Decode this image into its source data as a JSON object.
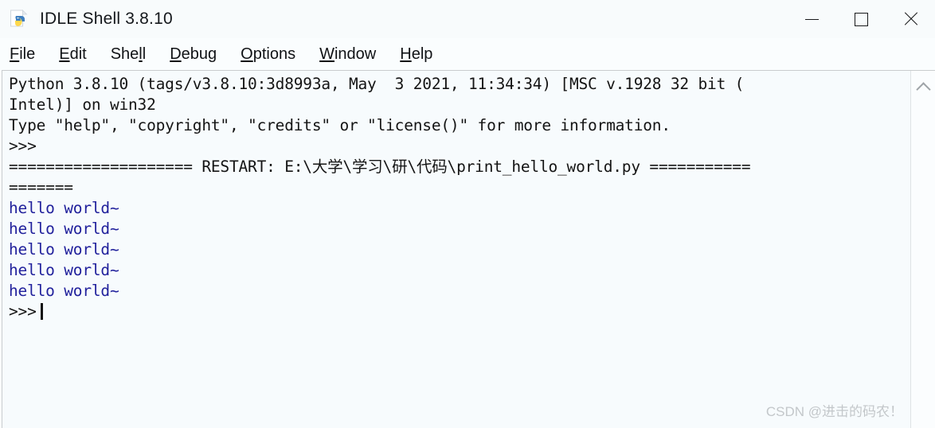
{
  "window": {
    "title": "IDLE Shell 3.8.10",
    "icon": "idle-python-icon",
    "controls": {
      "minimize": "—",
      "maximize": "☐",
      "close": "×"
    }
  },
  "menubar": {
    "items": [
      {
        "label": "File",
        "before": "",
        "mnemonic": "F",
        "after": "ile"
      },
      {
        "label": "Edit",
        "before": "",
        "mnemonic": "E",
        "after": "dit"
      },
      {
        "label": "Shell",
        "before": "She",
        "mnemonic": "l",
        "after": "l"
      },
      {
        "label": "Debug",
        "before": "",
        "mnemonic": "D",
        "after": "ebug"
      },
      {
        "label": "Options",
        "before": "",
        "mnemonic": "O",
        "after": "ptions"
      },
      {
        "label": "Window",
        "before": "",
        "mnemonic": "W",
        "after": "indow"
      },
      {
        "label": "Help",
        "before": "",
        "mnemonic": "H",
        "after": "elp"
      }
    ]
  },
  "shell": {
    "background_color": "#f7fbfd",
    "stdout_color": "#21219c",
    "text_color": "#141414",
    "lines": [
      {
        "kind": "banner",
        "text": "Python 3.8.10 (tags/v3.8.10:3d8993a, May  3 2021, 11:34:34) [MSC v.1928 32 bit ("
      },
      {
        "kind": "banner",
        "text": "Intel)] on win32"
      },
      {
        "kind": "banner",
        "text": "Type \"help\", \"copyright\", \"credits\" or \"license()\" for more information."
      },
      {
        "kind": "prompt",
        "text": ">>>"
      },
      {
        "kind": "restart",
        "text": "==================== RESTART: E:\\大学\\学习\\研\\代码\\print_hello_world.py ==========="
      },
      {
        "kind": "restart",
        "text": "======="
      },
      {
        "kind": "stdout",
        "text": "hello world~"
      },
      {
        "kind": "stdout",
        "text": "hello world~"
      },
      {
        "kind": "stdout",
        "text": "hello world~"
      },
      {
        "kind": "stdout",
        "text": "hello world~"
      },
      {
        "kind": "stdout",
        "text": "hello world~"
      },
      {
        "kind": "prompt_cursor",
        "text": ">>>"
      }
    ]
  },
  "scrollbar": {
    "up_arrow": "chevron-up-icon"
  },
  "watermark": {
    "text": "CSDN @进击的码农！"
  }
}
